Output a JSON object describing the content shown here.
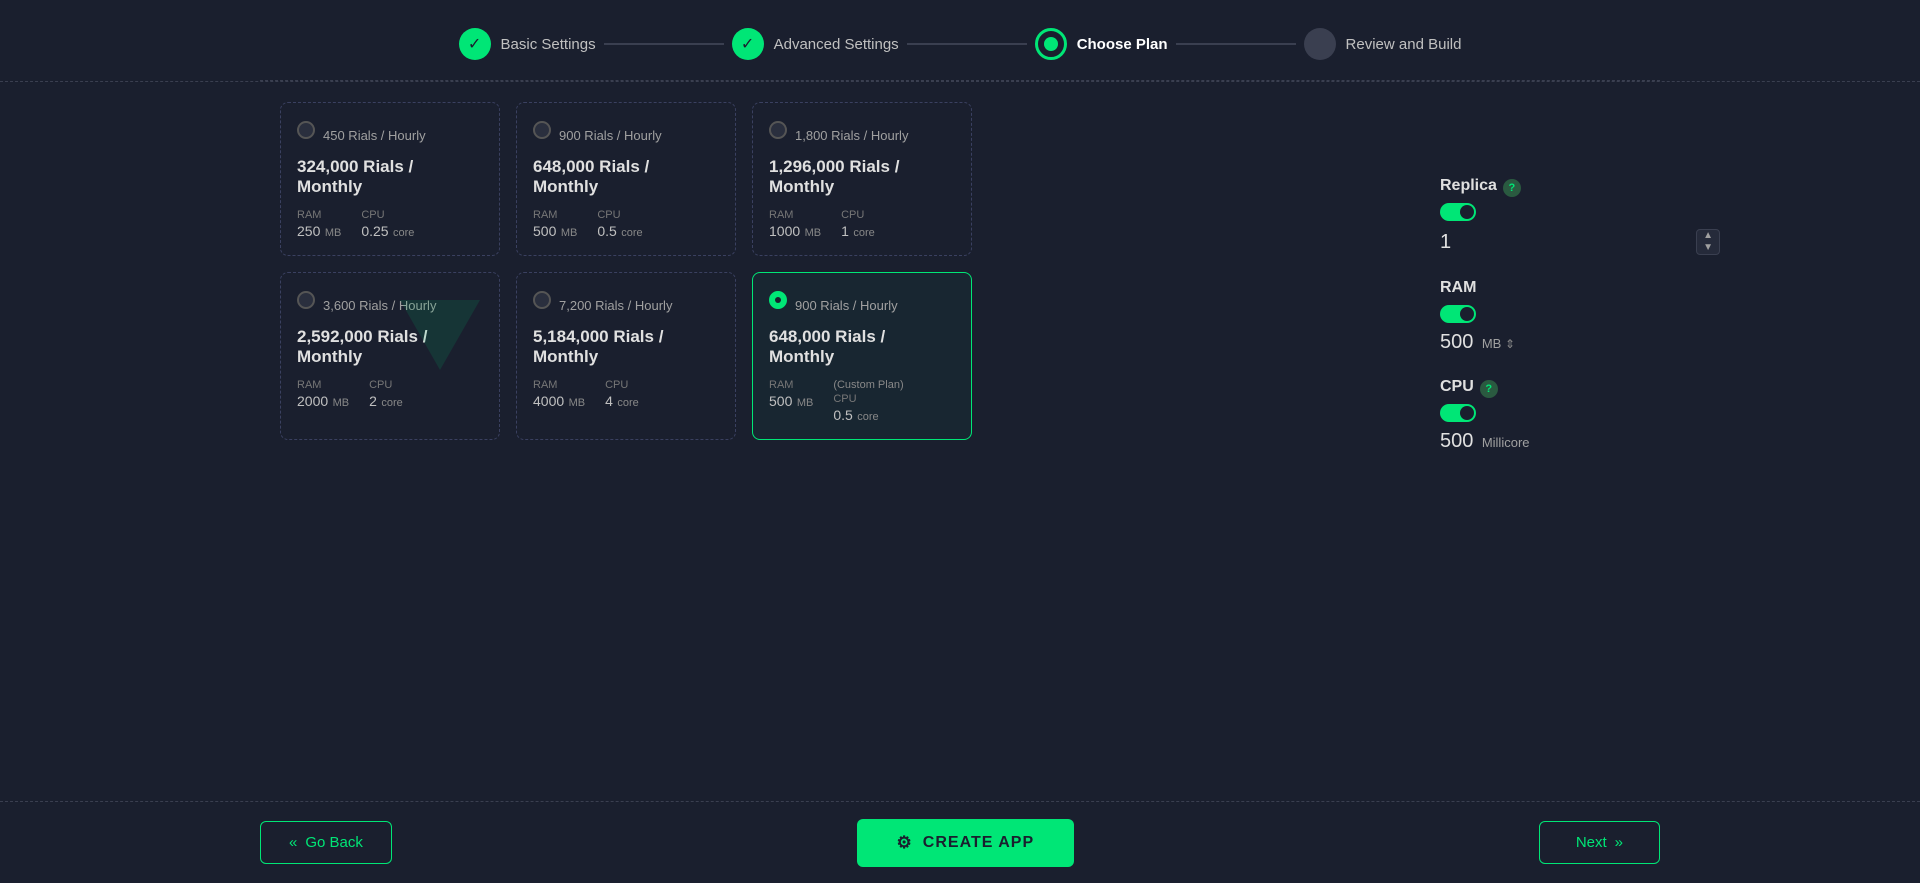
{
  "stepper": {
    "steps": [
      {
        "id": "basic-settings",
        "label": "Basic Settings",
        "state": "completed"
      },
      {
        "id": "advanced-settings",
        "label": "Advanced Settings",
        "state": "completed"
      },
      {
        "id": "choose-plan",
        "label": "Choose Plan",
        "state": "active"
      },
      {
        "id": "review-and-build",
        "label": "Review and Build",
        "state": "inactive"
      }
    ]
  },
  "plans": [
    {
      "id": "plan-1",
      "hourly": "450 Rials / Hourly",
      "monthly": "324,000 Rials / Monthly",
      "ram_label": "RAM",
      "ram_value": "250",
      "ram_unit": "MB",
      "cpu_label": "CPU",
      "cpu_value": "0.25",
      "cpu_unit": "core",
      "selected": false
    },
    {
      "id": "plan-2",
      "hourly": "900 Rials / Hourly",
      "monthly": "648,000 Rials / Monthly",
      "ram_label": "RAM",
      "ram_value": "500",
      "ram_unit": "MB",
      "cpu_label": "CPU",
      "cpu_value": "0.5",
      "cpu_unit": "core",
      "selected": false
    },
    {
      "id": "plan-3",
      "hourly": "1,800 Rials / Hourly",
      "monthly": "1,296,000 Rials / Monthly",
      "ram_label": "RAM",
      "ram_value": "1000",
      "ram_unit": "MB",
      "cpu_label": "CPU",
      "cpu_value": "1",
      "cpu_unit": "core",
      "selected": false
    },
    {
      "id": "plan-4",
      "hourly": "3,600 Rials / Hourly",
      "monthly": "2,592,000 Rials / Monthly",
      "ram_label": "RAM",
      "ram_value": "2000",
      "ram_unit": "MB",
      "cpu_label": "CPU",
      "cpu_value": "2",
      "cpu_unit": "core",
      "selected": false
    },
    {
      "id": "plan-5",
      "hourly": "7,200 Rials / Hourly",
      "monthly": "5,184,000 Rials / Monthly",
      "ram_label": "RAM",
      "ram_value": "4000",
      "ram_unit": "MB",
      "cpu_label": "CPU",
      "cpu_value": "4",
      "cpu_unit": "core",
      "selected": false
    },
    {
      "id": "plan-custom",
      "hourly": "900 Rials / Hourly",
      "monthly": "648,000 Rials / Monthly",
      "ram_label": "RAM",
      "ram_value": "500",
      "ram_unit": "MB",
      "cpu_label": "CPU",
      "cpu_value": "0.5",
      "cpu_unit": "core",
      "custom_label": "(Custom Plan)",
      "selected": true
    }
  ],
  "right_panel": {
    "replica_label": "Replica",
    "replica_value": "1",
    "ram_label": "RAM",
    "ram_value": "500",
    "ram_unit": "MB",
    "cpu_label": "CPU",
    "cpu_value": "500",
    "cpu_unit": "Millicore"
  },
  "footer": {
    "back_label": "Go Back",
    "create_label": "CREATE APP",
    "next_label": "Next"
  }
}
